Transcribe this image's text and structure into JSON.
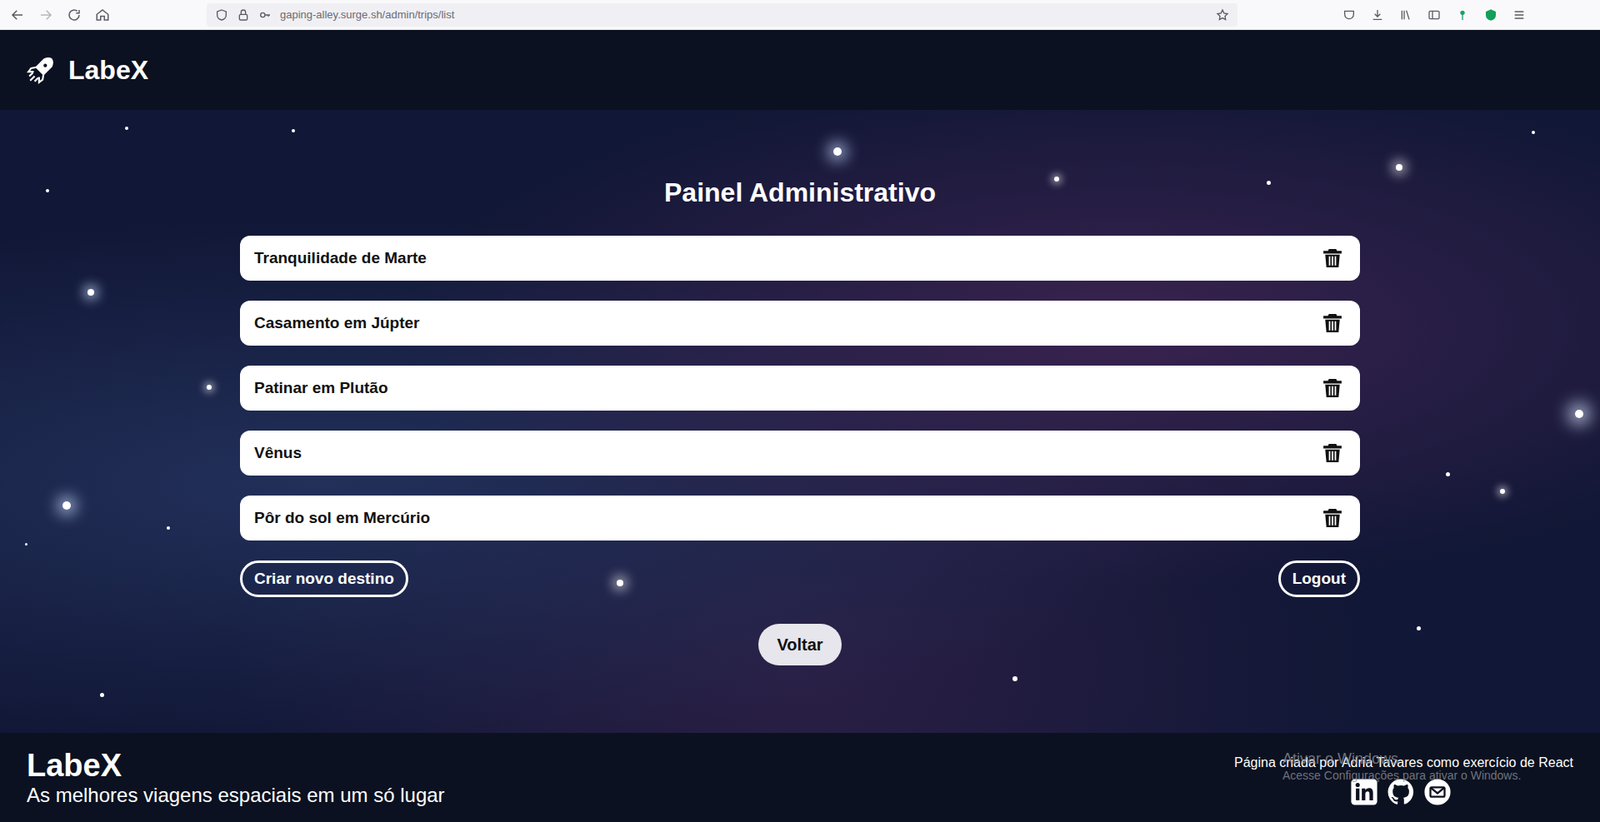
{
  "browser": {
    "url": "gaping-alley.surge.sh/admin/trips/list"
  },
  "header": {
    "brand": "LabeX"
  },
  "page": {
    "title": "Painel Administrativo"
  },
  "trips": [
    {
      "name": "Tranquilidade de Marte"
    },
    {
      "name": "Casamento em Júpter"
    },
    {
      "name": "Patinar em Plutão"
    },
    {
      "name": "Vênus"
    },
    {
      "name": "Pôr do sol em Mercúrio"
    }
  ],
  "actions": {
    "create": "Criar novo destino",
    "logout": "Logout",
    "back": "Voltar"
  },
  "footer": {
    "brand": "LabeX",
    "tagline": "As melhores viagens espaciais em um só lugar",
    "credit": "Página criada por Adria Tavares como exercício de React"
  },
  "watermark": {
    "title": "Ativar o Windows",
    "subtitle": "Acesse Configurações para ativar o Windows."
  }
}
